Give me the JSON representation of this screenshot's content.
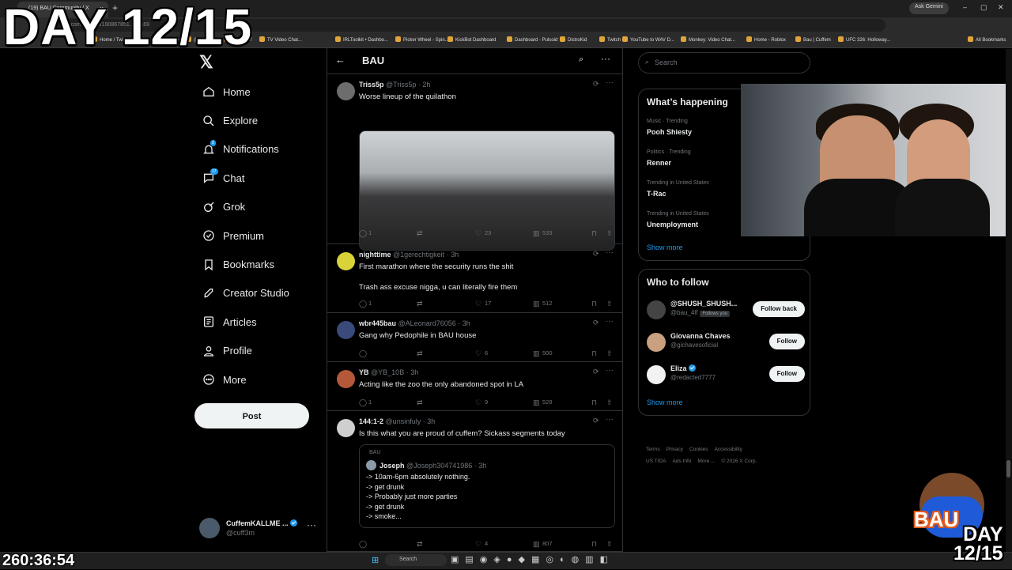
{
  "browser": {
    "tab_title": "(19) BAU Community / X",
    "url": "x.com/i/status/190867851...02169",
    "ask_gemini": "Ask Gemini",
    "all_bookmarks": "All Bookmarks",
    "bookmarks": [
      "Home / Twitter",
      "Cuffem",
      "(57) YouTube",
      "MONKEY",
      "TV Video Chat...",
      "IRLToolkit • Dashbo...",
      "Picker Wheel - Spin...",
      "KickBot Dashboard",
      "Dashboard - Pulsoid",
      "DistroKid",
      "Twitch",
      "YouTube to WAV D...",
      "Monkey: Video Chat...",
      "Home - Roblox",
      "Bau | Cuffem",
      "UFC 326: Holloway..."
    ]
  },
  "overlay": {
    "day_title": "DAY 12/15",
    "timer": "260:36:54",
    "corner_day": "DAY",
    "corner_count": "12/15",
    "mascot_text": "BAU"
  },
  "nav": {
    "items": [
      {
        "label": "Home",
        "icon": "home-icon"
      },
      {
        "label": "Explore",
        "icon": "search-icon"
      },
      {
        "label": "Notifications",
        "icon": "bell-icon",
        "badge": "2"
      },
      {
        "label": "Chat",
        "icon": "chat-icon",
        "badge": "17"
      },
      {
        "label": "Grok",
        "icon": "grok-icon"
      },
      {
        "label": "Premium",
        "icon": "premium-icon"
      },
      {
        "label": "Bookmarks",
        "icon": "bookmark-icon"
      },
      {
        "label": "Creator Studio",
        "icon": "rocket-icon"
      },
      {
        "label": "Articles",
        "icon": "article-icon"
      },
      {
        "label": "Profile",
        "icon": "profile-icon"
      },
      {
        "label": "More",
        "icon": "more-circle-icon"
      }
    ],
    "post_label": "Post",
    "account": {
      "name": "CuffemKALLME ...",
      "handle": "@cuff3m"
    }
  },
  "community": {
    "title": "BAU"
  },
  "tweets": [
    {
      "name": "Triss5p",
      "handle": "@Triss5p",
      "time": "· 2h",
      "text": [
        "Worse lineup of the quilathon"
      ],
      "replies": "1",
      "retweets": "",
      "likes": "23",
      "views": "533"
    },
    {
      "name": "nighttime",
      "handle": "@1gerechtigkeit",
      "time": "· 3h",
      "text": [
        "First marathon where the security runs the shit",
        "",
        "Trash ass excuse nigga, u can literally fire them"
      ],
      "replies": "1",
      "retweets": "",
      "likes": "17",
      "views": "512"
    },
    {
      "name": "wbr445bau",
      "handle": "@ALeonard76056",
      "time": "· 3h",
      "text": [
        "Gang why Pedophile in BAU house"
      ],
      "replies": "",
      "retweets": "",
      "likes": "6",
      "views": "500"
    },
    {
      "name": "YB",
      "handle": "@YB_10B",
      "time": "· 3h",
      "text": [
        "Acting like the zoo the only abandoned spot in LA"
      ],
      "replies": "1",
      "retweets": "",
      "likes": "9",
      "views": "528"
    },
    {
      "name": "144:1-2",
      "handle": "@unsinfuly",
      "time": "· 3h",
      "text": [
        "Is this what you are proud of cuffem? Sickass segments today"
      ],
      "replies": "",
      "retweets": "",
      "likes": "4",
      "views": "807",
      "quote": {
        "context": "BAU",
        "name": "Joseph",
        "handle": "@Joseph304741986",
        "time": "· 3h",
        "lines": [
          "-> 10am-6pm absolutely nothing.",
          "-> get drunk",
          "-> Probably just more parties",
          "-> get drunk",
          "-> smoke..."
        ]
      }
    }
  ],
  "right": {
    "search_placeholder": "Search",
    "whats_happening": "What’s happening",
    "trends": [
      {
        "meta": "Music · Trending",
        "name": "Pooh Shiesty"
      },
      {
        "meta": "Politics · Trending",
        "name": "Renner"
      },
      {
        "meta": "Trending in United States",
        "name": "T-Rac"
      },
      {
        "meta": "Trending in United States",
        "name": "Unemployment"
      }
    ],
    "show_more": "Show more",
    "who_to_follow": "Who to follow",
    "follow": [
      {
        "name": "@SHUSH_SHUSH...",
        "handle": "@bau_4lf",
        "follows_you": "Follows you",
        "button": "Follow back"
      },
      {
        "name": "Giovanna Chaves",
        "handle": "@gichavesoficial",
        "button": "Follow"
      },
      {
        "name": "Eliza",
        "handle": "@redacted7777",
        "button": "Follow"
      }
    ],
    "footer_1": [
      "Terms",
      "Privacy",
      "Cookies",
      "Accessibility"
    ],
    "footer_2": [
      "US TIDA",
      "Ads Info",
      "More ...",
      "© 2026 X Corp."
    ]
  },
  "taskbar": {
    "search": "Search"
  },
  "colors": {
    "accent": "#1d9bf0",
    "background": "#000000",
    "border": "#2f3336",
    "muted": "#71767b"
  }
}
